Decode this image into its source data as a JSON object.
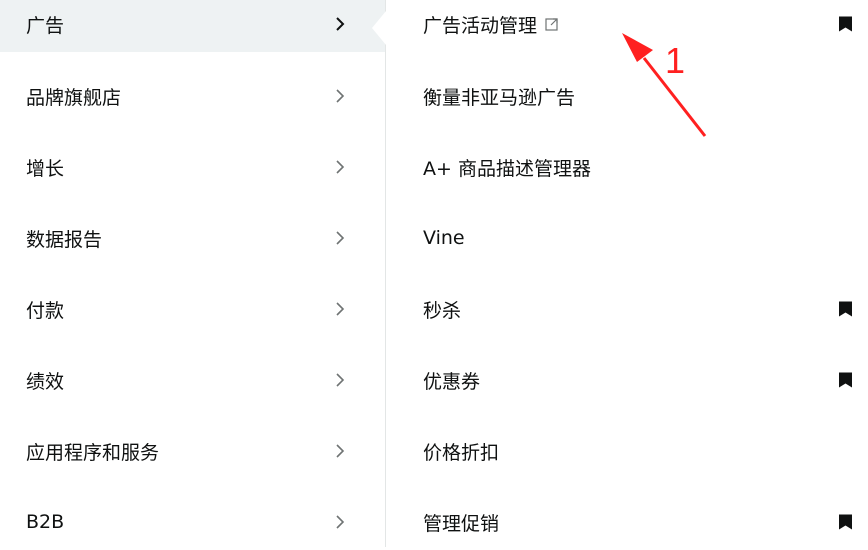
{
  "left_menu": {
    "items": [
      {
        "label": "广告"
      },
      {
        "label": "品牌旗舰店"
      },
      {
        "label": "增长"
      },
      {
        "label": "数据报告"
      },
      {
        "label": "付款"
      },
      {
        "label": "绩效"
      },
      {
        "label": "应用程序和服务"
      },
      {
        "label": "B2B"
      }
    ]
  },
  "right_menu": {
    "items": [
      {
        "label": "广告活动管理"
      },
      {
        "label": "衡量非亚马逊广告"
      },
      {
        "label": "A+ 商品描述管理器"
      },
      {
        "label": "Vine"
      },
      {
        "label": "秒杀"
      },
      {
        "label": "优惠券"
      },
      {
        "label": "价格折扣"
      },
      {
        "label": "管理促销"
      }
    ]
  },
  "annotation": {
    "label": "1",
    "color": "#ff2020"
  },
  "colors": {
    "active_bg": "#eef2f3",
    "text": "#0f1111",
    "divider": "#e3e6e6"
  }
}
